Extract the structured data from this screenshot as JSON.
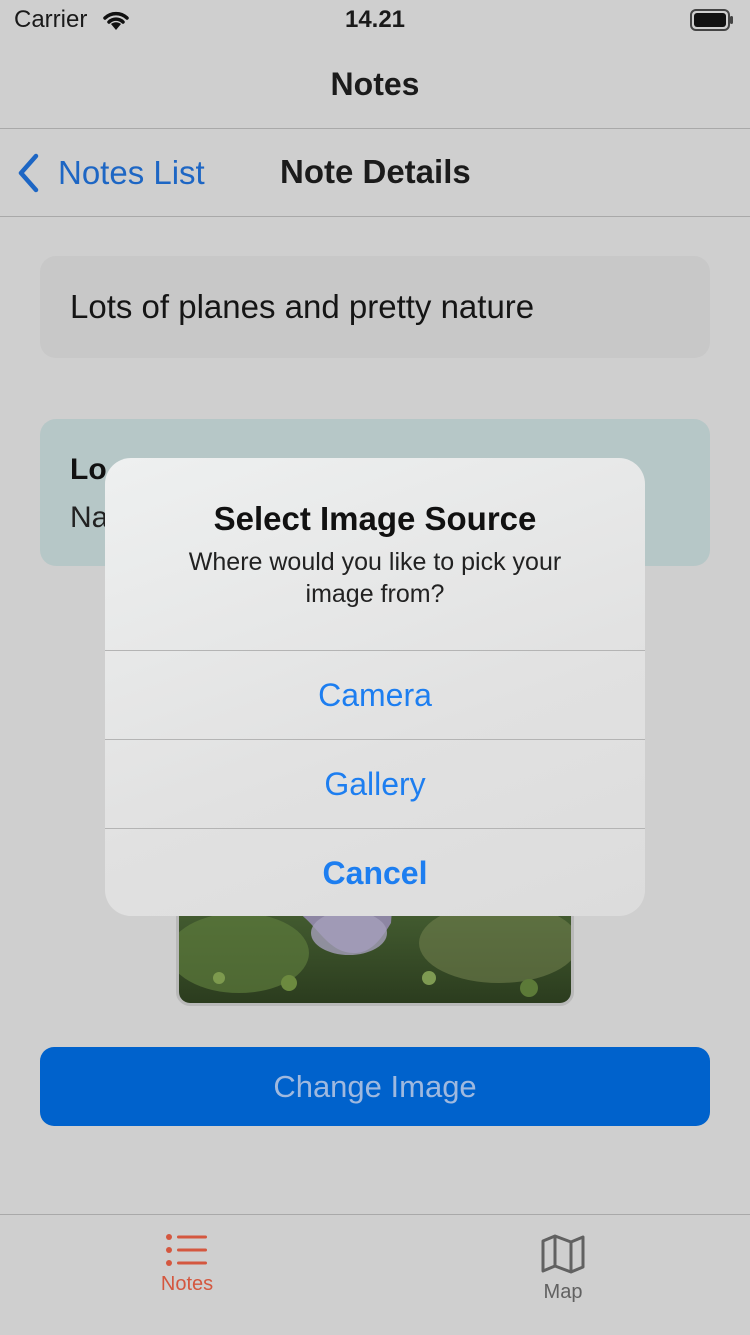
{
  "status_bar": {
    "carrier": "Carrier",
    "time": "14.21"
  },
  "top_nav": {
    "title": "Notes"
  },
  "detail_nav": {
    "back_label": "Notes List",
    "title": "Note Details"
  },
  "note": {
    "text": "Lots of planes and pretty nature"
  },
  "location": {
    "heading_visible": "Lo",
    "value_visible": "Na"
  },
  "change_image_button": "Change Image",
  "alert": {
    "title": "Select Image Source",
    "message": "Where would you like to pick your image from?",
    "actions": {
      "camera": "Camera",
      "gallery": "Gallery",
      "cancel": "Cancel"
    }
  },
  "tab_bar": {
    "tabs": [
      {
        "label": "Notes",
        "icon": "list-icon",
        "selected": true
      },
      {
        "label": "Map",
        "icon": "map-icon",
        "selected": false
      }
    ]
  },
  "colors": {
    "accent": "#1d7ef0",
    "tab_selected": "#d4573f",
    "button_bg": "#0062cc"
  }
}
